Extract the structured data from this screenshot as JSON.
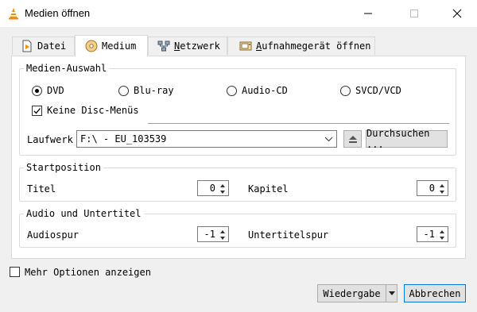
{
  "window": {
    "title": "Medien öffnen"
  },
  "tabs": [
    {
      "label": "Datei",
      "icon": "file-icon"
    },
    {
      "label": "Medium",
      "icon": "disc-icon"
    },
    {
      "label": "Netzwerk",
      "icon": "network-icon"
    },
    {
      "label": "Aufnahmegerät öffnen",
      "icon": "capture-device-icon"
    }
  ],
  "media_selection": {
    "title": "Medien-Auswahl",
    "options": [
      "DVD",
      "Blu-ray",
      "Audio-CD",
      "SVCD/VCD"
    ],
    "selected": "DVD",
    "no_disc_menus": "Keine Disc-Menüs",
    "no_disc_menus_checked": true,
    "drive_label": "Laufwerk",
    "drive_value": "F:\\ - EU_103539",
    "browse_label": "Durchsuchen ..."
  },
  "start_position": {
    "title": "Startposition",
    "title_label": "Titel",
    "title_value": "0",
    "chapter_label": "Kapitel",
    "chapter_value": "0"
  },
  "audio_subtitles": {
    "title": "Audio und Untertitel",
    "audio_label": "Audiospur",
    "audio_value": "-1",
    "subtitle_label": "Untertitelspur",
    "subtitle_value": "-1"
  },
  "footer": {
    "more_options": "Mehr Optionen anzeigen",
    "more_options_checked": false,
    "play_label": "Wiedergabe",
    "cancel_label": "Abbrechen"
  },
  "colors": {
    "accent": "#0078d7",
    "vlc_orange": "#f08c00"
  }
}
